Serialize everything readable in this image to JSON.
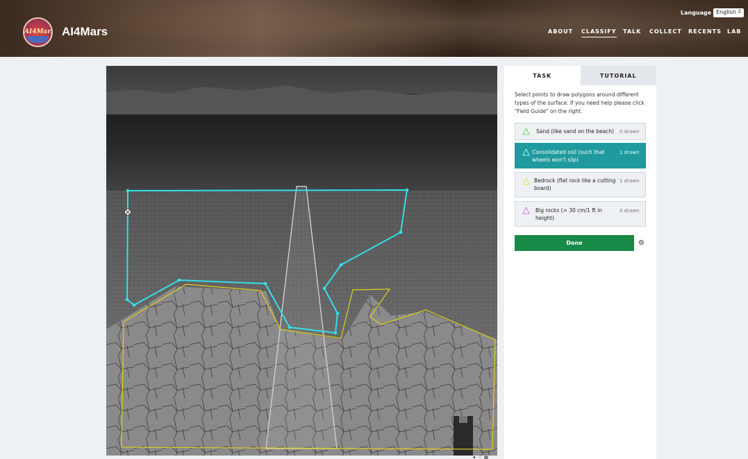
{
  "header": {
    "brand": "AI4Mars",
    "logo_text": "AI4Mars",
    "language_label": "Language",
    "language_value": "English",
    "nav": [
      {
        "label": "ABOUT",
        "active": false
      },
      {
        "label": "CLASSIFY",
        "active": true
      },
      {
        "label": "TALK",
        "active": false
      },
      {
        "label": "COLLECT",
        "active": false
      },
      {
        "label": "RECENTS",
        "active": false
      },
      {
        "label": "LAB",
        "active": false
      }
    ]
  },
  "viewer": {
    "polygons": [
      {
        "class": "Consolidated soil",
        "color": "#33e0e8"
      },
      {
        "class": "Bedrock",
        "color": "#e0d020"
      },
      {
        "class": "Rover track mask",
        "color": "#d0d0d0"
      }
    ]
  },
  "panel": {
    "tabs": [
      {
        "label": "TASK",
        "active": true
      },
      {
        "label": "TUTORIAL",
        "active": false
      }
    ],
    "instructions": "Select points to draw polygons around different types of the surface. If you need help please click \"Field Guide\" on the right.",
    "tools": [
      {
        "label": "Sand (like sand on the beach)",
        "count": "0 drawn",
        "color": "#6ed66e",
        "selected": false
      },
      {
        "label": "Consolidated soil (such that wheels won't slip)",
        "count": "1 drawn",
        "color": "#33e0e8",
        "selected": true
      },
      {
        "label": "Bedrock (flat rock like a cutting board)",
        "count": "1 drawn",
        "color": "#e8e04a",
        "selected": false
      },
      {
        "label": "Big rocks (> 30 cm/1 ft in height)",
        "count": "0 drawn",
        "color": "#d878e8",
        "selected": false
      }
    ],
    "done_label": "Done"
  }
}
